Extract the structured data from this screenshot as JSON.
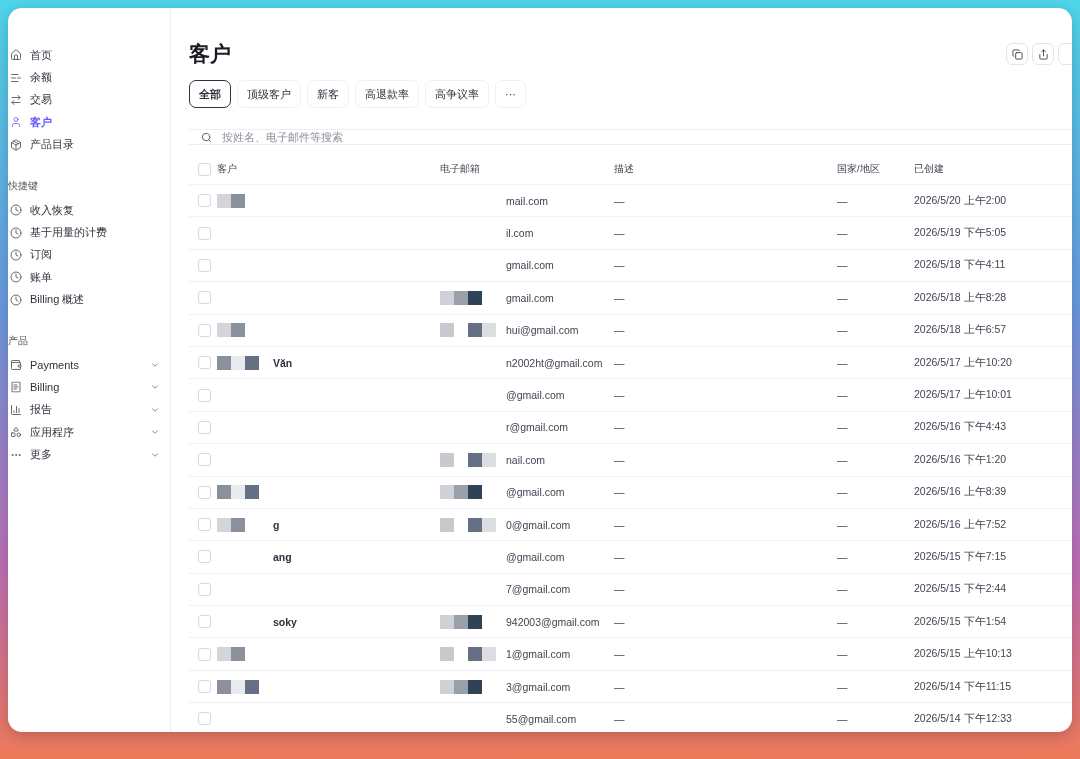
{
  "sidebar": {
    "main_items": [
      {
        "label": "首页",
        "selected": false
      },
      {
        "label": "余额",
        "selected": false
      },
      {
        "label": "交易",
        "selected": false
      },
      {
        "label": "客户",
        "selected": true
      },
      {
        "label": "产品目录",
        "selected": false
      }
    ],
    "sections": [
      {
        "title": "快捷键",
        "items": [
          {
            "label": "收入恢复",
            "selected": false
          },
          {
            "label": "基于用量的计费",
            "selected": false
          },
          {
            "label": "订阅",
            "selected": false
          },
          {
            "label": "账单",
            "selected": false
          },
          {
            "label": "Billing 概述",
            "selected": false
          }
        ]
      },
      {
        "title": "产品",
        "items": [
          {
            "label": "Payments",
            "selected": false,
            "expanded": false
          },
          {
            "label": "Billing",
            "selected": false,
            "expanded": false
          },
          {
            "label": "报告",
            "selected": false,
            "expanded": false
          },
          {
            "label": "应用程序",
            "selected": false,
            "expanded": false
          },
          {
            "label": "更多",
            "selected": false,
            "expanded": false
          }
        ]
      }
    ]
  },
  "page": {
    "title": "客户",
    "tabs": [
      {
        "label": "全部",
        "selected": true
      },
      {
        "label": "顶级客户",
        "selected": false
      },
      {
        "label": "新客",
        "selected": false
      },
      {
        "label": "高退款率",
        "selected": false
      },
      {
        "label": "高争议率",
        "selected": false
      },
      {
        "label": "···",
        "selected": false
      }
    ],
    "search": {
      "placeholder": "按姓名、电子邮件等搜索"
    },
    "table": {
      "columns": [
        "客户",
        "电子邮箱",
        "描述",
        "国家/地区",
        "已创建"
      ],
      "all_checked": false,
      "rows": [
        {
          "checked": false,
          "customer": "",
          "name_mosaic": true,
          "email": "mail.com",
          "email_mosaic": false,
          "description": "—",
          "country": "—",
          "created": "2026/5/20 上午2:00"
        },
        {
          "checked": false,
          "customer": "",
          "name_mosaic": false,
          "email": "il.com",
          "email_mosaic": false,
          "description": "—",
          "country": "—",
          "created": "2026/5/19 下午5:05"
        },
        {
          "checked": false,
          "customer": "",
          "name_mosaic": false,
          "email": "gmail.com",
          "email_mosaic": false,
          "description": "—",
          "country": "—",
          "created": "2026/5/18 下午4:11"
        },
        {
          "checked": false,
          "customer": "",
          "name_mosaic": false,
          "email": "gmail.com",
          "email_mosaic": true,
          "description": "—",
          "country": "—",
          "created": "2026/5/18 上午8:28"
        },
        {
          "checked": false,
          "customer": "",
          "name_mosaic": true,
          "email": "hui@gmail.com",
          "email_mosaic": true,
          "description": "—",
          "country": "—",
          "created": "2026/5/18 上午6:57"
        },
        {
          "checked": false,
          "customer": "Văn",
          "name_mosaic": true,
          "email": "n2002ht@gmail.com",
          "email_mosaic": false,
          "description": "—",
          "country": "—",
          "created": "2026/5/17 上午10:20"
        },
        {
          "checked": false,
          "customer": "",
          "name_mosaic": false,
          "email": "@gmail.com",
          "email_mosaic": false,
          "description": "—",
          "country": "—",
          "created": "2026/5/17 上午10:01"
        },
        {
          "checked": false,
          "customer": "",
          "name_mosaic": false,
          "email": "r@gmail.com",
          "email_mosaic": false,
          "description": "—",
          "country": "—",
          "created": "2026/5/16 下午4:43"
        },
        {
          "checked": false,
          "customer": "",
          "name_mosaic": false,
          "email": "nail.com",
          "email_mosaic": true,
          "description": "—",
          "country": "—",
          "created": "2026/5/16 下午1:20"
        },
        {
          "checked": false,
          "customer": "",
          "name_mosaic": true,
          "email": "@gmail.com",
          "email_mosaic": true,
          "description": "—",
          "country": "—",
          "created": "2026/5/16 上午8:39"
        },
        {
          "checked": false,
          "customer": "g",
          "name_mosaic": true,
          "email": "0@gmail.com",
          "email_mosaic": true,
          "description": "—",
          "country": "—",
          "created": "2026/5/16 上午7:52"
        },
        {
          "checked": false,
          "customer": "ang",
          "name_mosaic": false,
          "email": "@gmail.com",
          "email_mosaic": false,
          "description": "—",
          "country": "—",
          "created": "2026/5/15 下午7:15"
        },
        {
          "checked": false,
          "customer": "",
          "name_mosaic": false,
          "email": "7@gmail.com",
          "email_mosaic": false,
          "description": "—",
          "country": "—",
          "created": "2026/5/15 下午2:44"
        },
        {
          "checked": false,
          "customer": "soky",
          "name_mosaic": false,
          "email": "942003@gmail.com",
          "email_mosaic": true,
          "description": "—",
          "country": "—",
          "created": "2026/5/15 下午1:54"
        },
        {
          "checked": false,
          "customer": "",
          "name_mosaic": true,
          "email": "1@gmail.com",
          "email_mosaic": true,
          "description": "—",
          "country": "—",
          "created": "2026/5/15 上午10:13"
        },
        {
          "checked": false,
          "customer": "",
          "name_mosaic": true,
          "email": "3@gmail.com",
          "email_mosaic": true,
          "description": "—",
          "country": "—",
          "created": "2026/5/14 下午11:15"
        },
        {
          "checked": false,
          "customer": "",
          "name_mosaic": false,
          "email": "55@gmail.com",
          "email_mosaic": false,
          "description": "—",
          "country": "—",
          "created": "2026/5/14 下午12:33"
        }
      ]
    }
  }
}
